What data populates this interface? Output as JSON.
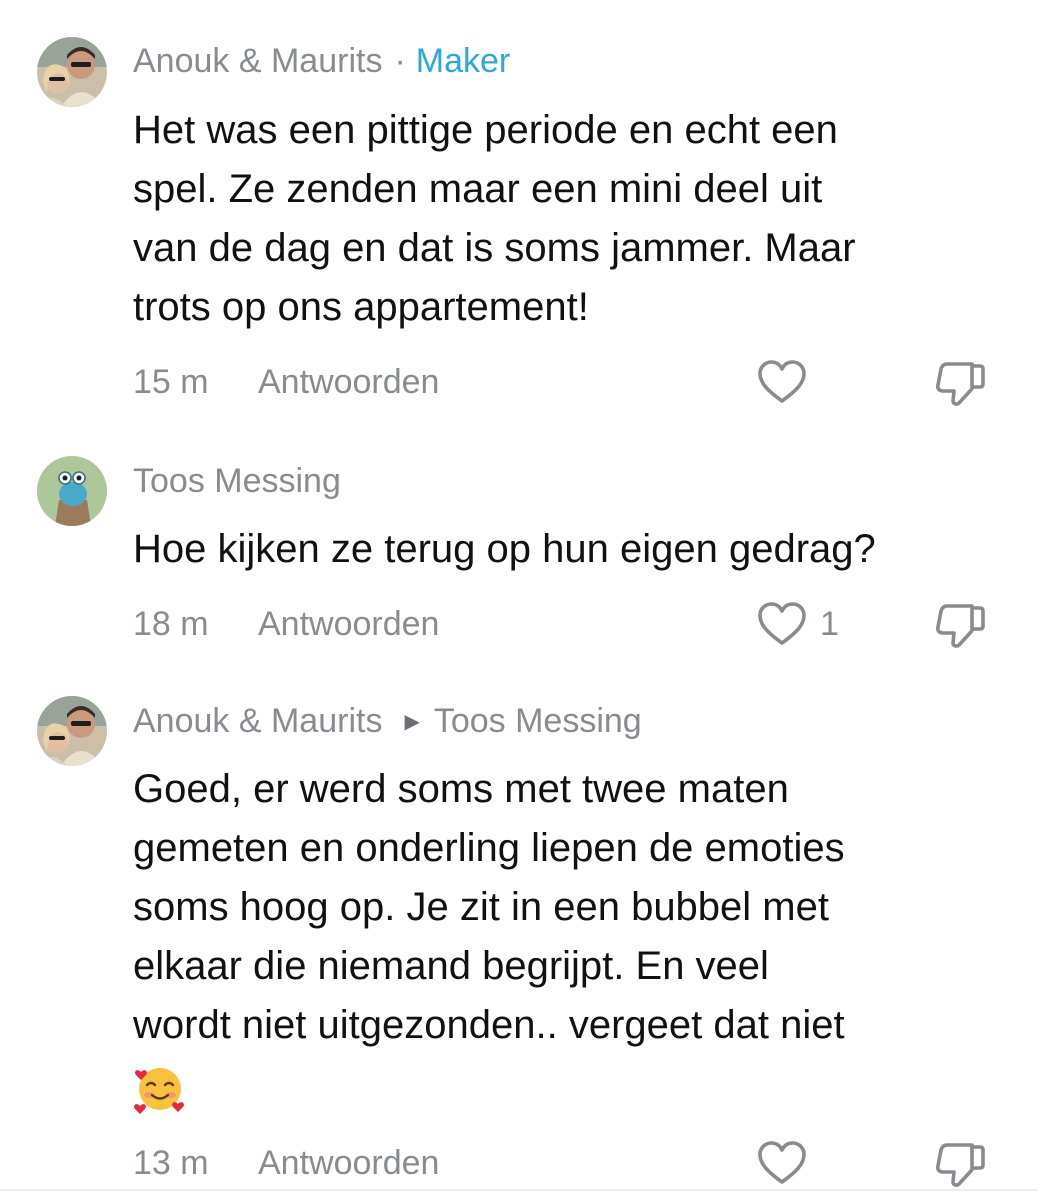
{
  "comments": [
    {
      "author": "Anouk & Maurits",
      "separator": "·",
      "badge": "Maker",
      "lines": [
        "Het was een pittige periode en echt een",
        "spel. Ze zenden maar een mini deel uit",
        "van de dag en dat is soms jammer. Maar",
        "trots op ons appartement!"
      ],
      "time": "15 m",
      "reply_label": "Antwoorden",
      "like_count": "",
      "icons": {
        "like": "heart-icon",
        "dislike": "thumbs-down-icon"
      }
    },
    {
      "author": "Toos Messing",
      "lines": [
        "Hoe kijken ze terug op hun eigen gedrag?"
      ],
      "time": "18 m",
      "reply_label": "Antwoorden",
      "like_count": "1",
      "icons": {
        "like": "heart-icon",
        "dislike": "thumbs-down-icon"
      }
    },
    {
      "author": "Anouk & Maurits",
      "reply_to": "Toos Messing",
      "lines": [
        "Goed, er werd soms met twee maten",
        "gemeten en onderling liepen de emoties",
        "soms hoog op. Je zit in een bubbel met",
        "elkaar die niemand begrijpt. En veel",
        "wordt niet uitgezonden.. vergeet dat niet"
      ],
      "emoji": "smiling-face-with-hearts",
      "time": "13 m",
      "reply_label": "Antwoorden",
      "like_count": "",
      "icons": {
        "like": "heart-icon",
        "dislike": "thumbs-down-icon"
      }
    }
  ],
  "colors": {
    "muted_text": "#8a8b91",
    "body_text": "#111111",
    "maker_badge": "#2aa8d8",
    "icon_stroke": "#8a8b91"
  }
}
